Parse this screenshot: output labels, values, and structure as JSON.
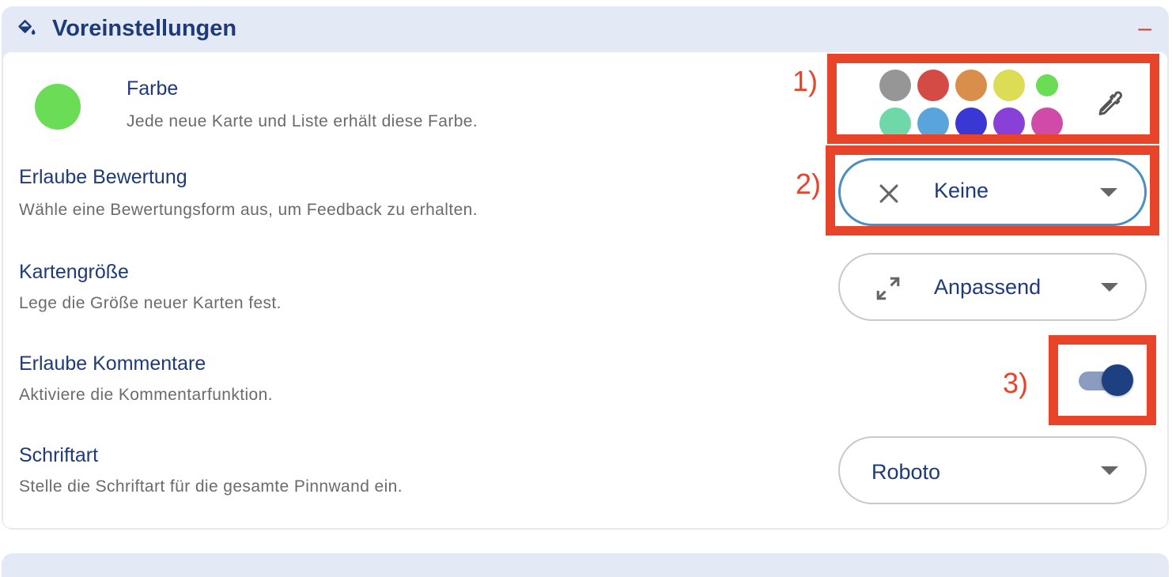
{
  "header": {
    "icon": "paint-bucket-icon",
    "title": "Voreinstellungen",
    "collapse_label": "–"
  },
  "colors": {
    "accent": "#1e3a78",
    "annotation": "#e8442a",
    "preset_color": "#6bdc55"
  },
  "farbe": {
    "title": "Farbe",
    "description": "Jede neue Karte und Liste erhält diese Farbe.",
    "swatches_row1": [
      "#969696",
      "#d44a44",
      "#d98f4b",
      "#dddd55",
      "#6bdc55"
    ],
    "swatches_row2": [
      "#6ed8a8",
      "#5aa4dc",
      "#3a38d4",
      "#8840d8",
      "#d04aa8"
    ],
    "picker_icon": "eyedropper-icon"
  },
  "bewertung": {
    "title": "Erlaube Bewertung",
    "description": "Wähle eine Bewertungsform aus, um Feedback zu erhalten.",
    "value": "Keine",
    "icon": "close-icon"
  },
  "kartengroesse": {
    "title": "Kartengröße",
    "description": "Lege die Größe neuer Karten fest.",
    "value": "Anpassend",
    "icon": "expand-icon"
  },
  "kommentare": {
    "title": "Erlaube Kommentare",
    "description": "Aktiviere die Kommentarfunktion.",
    "enabled": true
  },
  "schriftart": {
    "title": "Schriftart",
    "description": "Stelle die Schriftart für die gesamte Pinnwand ein.",
    "value": "Roboto"
  },
  "annotations": {
    "label_1": "1)",
    "label_2": "2)",
    "label_3": "3)"
  }
}
